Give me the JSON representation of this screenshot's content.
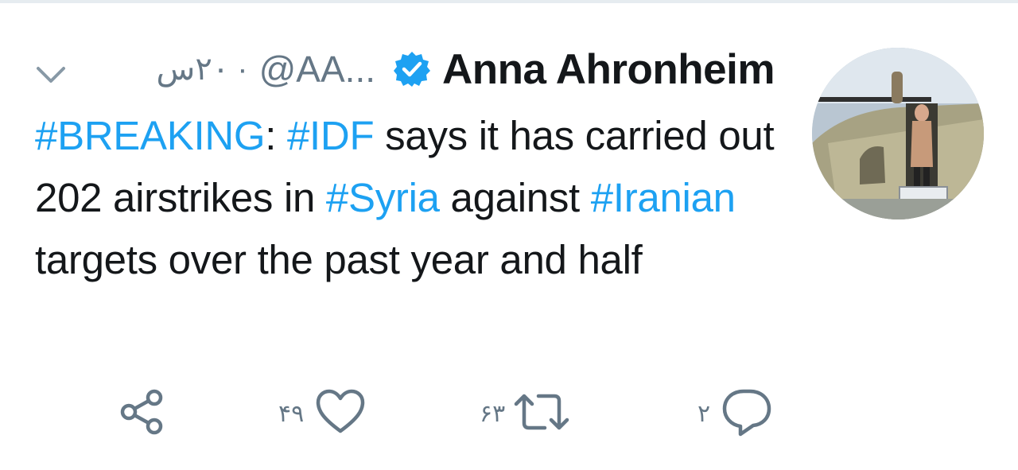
{
  "tweet": {
    "author_name": "Anna Ahronheim",
    "handle": "@AA...",
    "separator": "·",
    "time": "۲۰س",
    "text_parts": [
      {
        "text": "#BREAKING",
        "tag": true
      },
      {
        "text": ": ",
        "tag": false
      },
      {
        "text": "#IDF",
        "tag": true
      },
      {
        "text": " says it has carried out 202 airstrikes in ",
        "tag": false
      },
      {
        "text": "#Syria",
        "tag": true
      },
      {
        "text": " against ",
        "tag": false
      },
      {
        "text": "#Iranian",
        "tag": true
      },
      {
        "text": " targets over the past year and half",
        "tag": false
      }
    ]
  },
  "actions": {
    "reply_count": "۲",
    "retweet_count": "۶۳",
    "like_count": "۴۹"
  },
  "colors": {
    "link": "#1da1f2",
    "text": "#14171a",
    "muted": "#657786",
    "verified": "#1da1f2"
  },
  "icons": [
    "chevron-down-icon",
    "verified-badge-icon",
    "share-icon",
    "heart-icon",
    "retweet-icon",
    "reply-icon"
  ]
}
